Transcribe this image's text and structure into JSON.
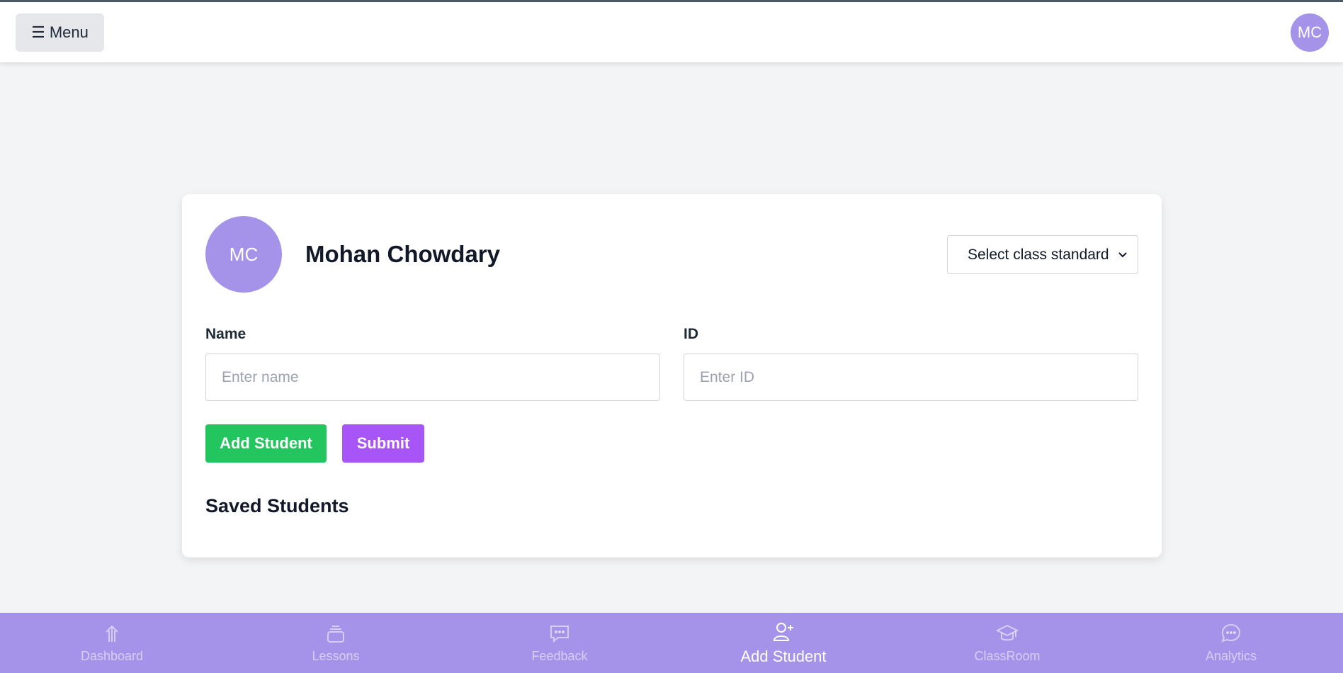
{
  "header": {
    "menu_icon": "☰",
    "menu_label": "Menu",
    "avatar_initials": "MC"
  },
  "profile": {
    "initials": "MC",
    "name": "Mohan Chowdary",
    "class_select": "Select class standard"
  },
  "form": {
    "name_label": "Name",
    "name_placeholder": "Enter name",
    "id_label": "ID",
    "id_placeholder": "Enter ID",
    "add_button": "Add Student",
    "submit_button": "Submit",
    "saved_heading": "Saved Students"
  },
  "nav": {
    "items": [
      {
        "label": "Dashboard",
        "icon": "arrow-up-icon"
      },
      {
        "label": "Lessons",
        "icon": "layers-icon"
      },
      {
        "label": "Feedback",
        "icon": "message-icon"
      },
      {
        "label": "Add Student",
        "icon": "user-plus-icon",
        "active": true
      },
      {
        "label": "ClassRoom",
        "icon": "graduation-cap-icon"
      },
      {
        "label": "Analytics",
        "icon": "chat-bubble-icon"
      }
    ]
  },
  "colors": {
    "accent": "#a593ea",
    "add_button": "#22c55e",
    "submit_button": "#a855f7"
  }
}
